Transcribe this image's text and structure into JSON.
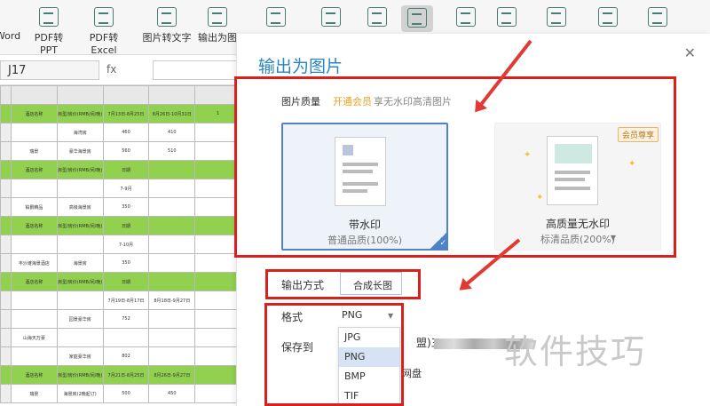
{
  "ribbon": {
    "items": [
      "Word",
      "PDF转PPT",
      "PDF转Excel",
      "图片转文字",
      "输出为图"
    ]
  },
  "formula_bar": {
    "cell_ref": "J17",
    "fx": "fx"
  },
  "sheet": {
    "rows": [
      [
        "酒店名称",
        "房型/房价(RMB/间/晚)",
        "7月13日-8月25日",
        "8月26日-10月31日",
        "1"
      ],
      [
        "",
        "海湾房",
        "460",
        "410",
        ""
      ],
      [
        "瑞景",
        "豪华海景房",
        "560",
        "510",
        ""
      ],
      [
        "酒店名称",
        "房型/房价(RMB/间/晚)",
        "日期",
        "",
        ""
      ],
      [
        "",
        "",
        "7-9月",
        "",
        ""
      ],
      [
        "铂爵精品",
        "高级海景房",
        "350",
        "",
        ""
      ],
      [
        "酒店名称",
        "房型/房价(RMB/间/晚)",
        "日期",
        "",
        ""
      ],
      [
        "",
        "",
        "7-10月",
        "",
        ""
      ],
      [
        "丰沙滩海景酒店",
        "海景房",
        "350",
        "",
        ""
      ],
      [
        "酒店名称",
        "房型/房价(RMB/间/晚)",
        "日期",
        "",
        ""
      ],
      [
        "",
        "",
        "7月19日-8月17日",
        "8月18日-9月27日",
        ""
      ],
      [
        "",
        "园景豪华房",
        "752",
        "",
        ""
      ],
      [
        "山海天万豪",
        "",
        "",
        "",
        ""
      ],
      [
        "",
        "家庭豪华房",
        "802",
        "",
        ""
      ],
      [
        "酒店名称",
        "房型/房价(RMB/间/晚)",
        "7月21日-8月25日",
        "8月26日-9月27日",
        ""
      ],
      [
        "瑞景",
        "海景房(2晚起订)",
        "500",
        "450",
        ""
      ]
    ]
  },
  "dialog": {
    "title": "输出为图片",
    "quality_label": "图片质量",
    "vip_link": "开通会员",
    "vip_desc": "享无水印高清图片",
    "card1": {
      "name": "带水印",
      "sub": "普通品质(100%)"
    },
    "card2": {
      "name": "高质量无水印",
      "sub": "标清品质(200%)",
      "badge": "会员尊享"
    },
    "output_mode_label": "输出方式",
    "output_mode_value": "合成长图",
    "format_label": "格式",
    "format_value": "PNG",
    "format_options": [
      "JPG",
      "PNG",
      "BMP",
      "TIF"
    ],
    "save_label": "保存到",
    "save_suffix": "盟)三",
    "cloud_disk": "网盘"
  },
  "watermark": "软件技巧",
  "colors": {
    "accent": "#2a86c2",
    "annotation_red": "#d9201a",
    "sheet_green": "#92d050"
  }
}
